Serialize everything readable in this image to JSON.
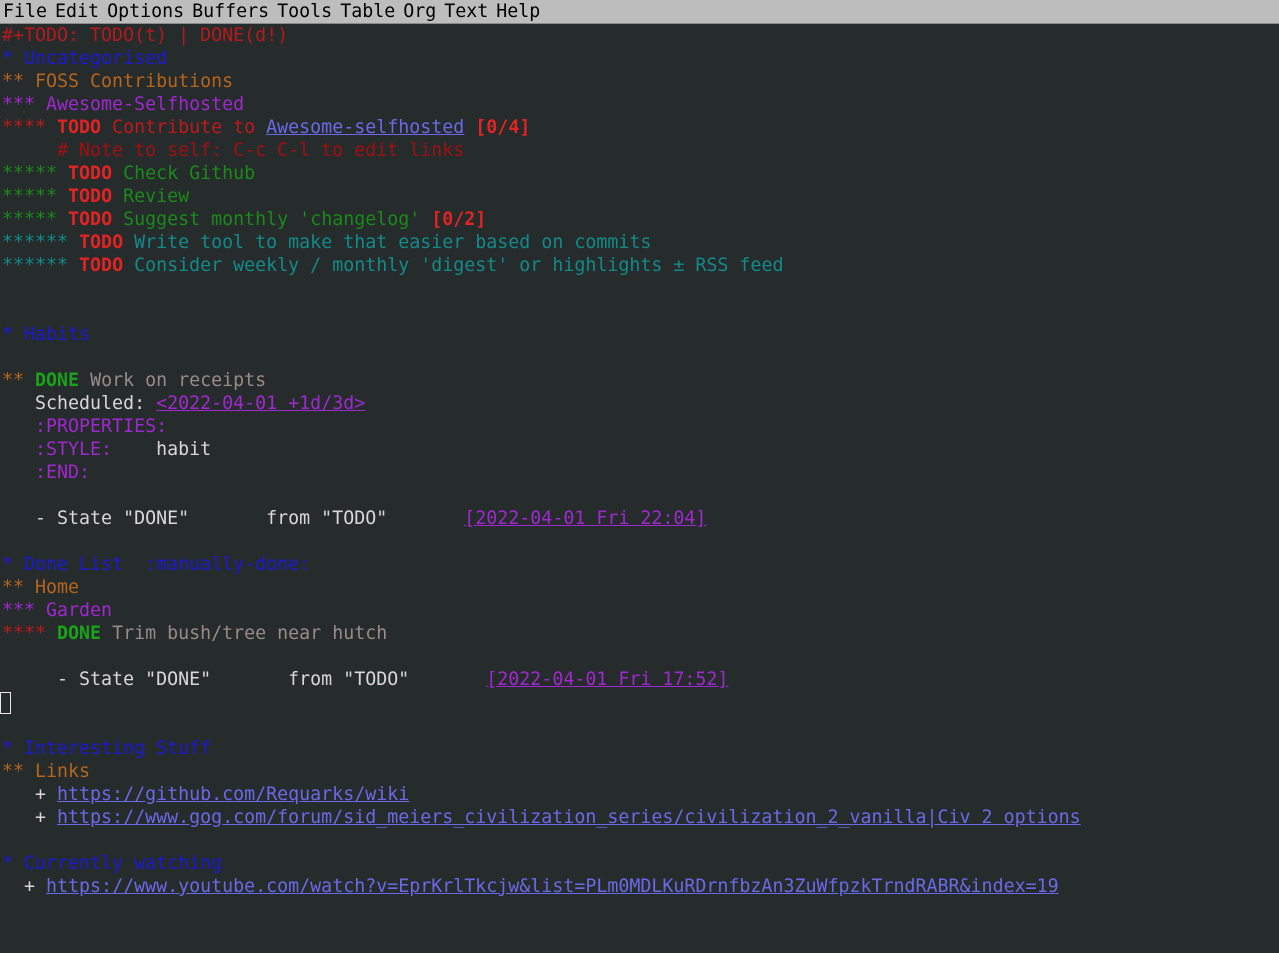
{
  "menu": [
    "File",
    "Edit",
    "Options",
    "Buffers",
    "Tools",
    "Table",
    "Org",
    "Text",
    "Help"
  ],
  "lines": {
    "l01": "#+TODO: TODO(t) | DONE(d!)",
    "l02": "* Uncategorised",
    "l03": "** FOSS Contributions",
    "l04": "*** Awesome-Selfhosted",
    "l05_stars": "**** ",
    "l05_kw": "TODO",
    "l05_text": " Contribute to ",
    "l05_link": "Awesome-selfhosted",
    "l05_count": "[0/4]",
    "l06": "     # Note to self: C-c C-l to edit links",
    "l07_stars": "***** ",
    "l07_kw": "TODO",
    "l07_text": " Check Github",
    "l08_stars": "***** ",
    "l08_kw": "TODO",
    "l08_text": " Review",
    "l09_stars": "***** ",
    "l09_kw": "TODO",
    "l09_text": " Suggest monthly 'changelog' ",
    "l09_count": "[0/2]",
    "l10_stars": "****** ",
    "l10_kw": "TODO",
    "l10_text": " Write tool to make that easier based on commits",
    "l11_stars": "****** ",
    "l11_kw": "TODO",
    "l11_text": " Consider weekly / monthly 'digest' or highlights ± RSS feed",
    "l14": "* Habits",
    "l16_stars": "** ",
    "l16_kw": "DONE",
    "l16_text": " Work on receipts",
    "l17_label": "   Scheduled: ",
    "l17_date": "<2022-04-01 +1d/3d>",
    "l18": "   :PROPERTIES:",
    "l19_key": "   :STYLE:",
    "l19_val": "    habit",
    "l20": "   :END:",
    "l22_text": "   - State \"DONE\"       from \"TODO\"       ",
    "l22_date": "[2022-04-01 Fri 22:04]",
    "l24_head": "* Done List  ",
    "l24_tag": ":manually-done:",
    "l25": "** Home",
    "l26": "*** Garden",
    "l27_stars": "**** ",
    "l27_kw": "DONE",
    "l27_text": " Trim bush/tree near hutch",
    "l29_text": "     - State \"DONE\"       from \"TODO\"       ",
    "l29_date": "[2022-04-01 Fri 17:52]",
    "l32": "* Interesting Stuff",
    "l33": "** Links",
    "l34_bullet": "   + ",
    "l34_link": "https://github.com/Requarks/wiki",
    "l35_bullet": "   + ",
    "l35_link": "https://www.gog.com/forum/sid_meiers_civilization_series/civilization_2_vanilla|Civ 2 options",
    "l37": "* Currently watching",
    "l38_bullet": "  + ",
    "l38_link": "https://www.youtube.com/watch?v=EprKrlTkcjw&list=PLm0MDLKuRDrnfbzAn3ZuWfpzkTrndRABR&index=19"
  },
  "colors": {
    "background": "#262b2c",
    "menubar": "#bdbdbd",
    "todo": "#e02424",
    "done": "#1aa21a",
    "link": "#6a6ae8",
    "level1": "#1a1ad4",
    "level2": "#b5651d",
    "level3": "#a028d0"
  }
}
